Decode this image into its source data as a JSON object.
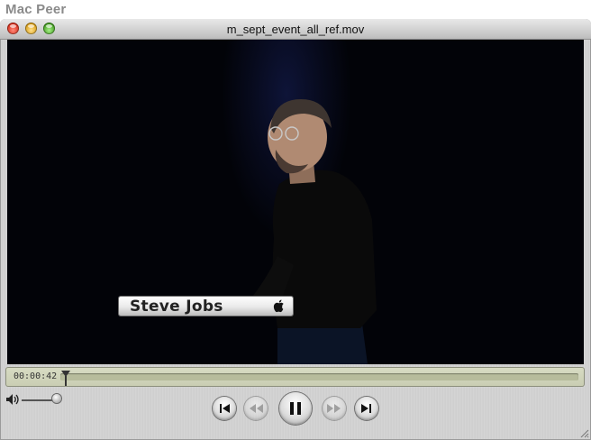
{
  "site": {
    "label": "Mac Peer"
  },
  "window": {
    "title": "m_sept_event_all_ref.mov"
  },
  "video": {
    "lower_third_name": "Steve Jobs",
    "lower_third_logo": "apple-logo-icon"
  },
  "scrubber": {
    "timecode": "00:00:42"
  },
  "controls": {
    "buttons": [
      {
        "name": "go-to-start-button",
        "icon": "skip-to-start-icon",
        "enabled": true
      },
      {
        "name": "rewind-button",
        "icon": "rewind-icon",
        "enabled": false
      },
      {
        "name": "pause-button",
        "icon": "pause-icon",
        "enabled": true
      },
      {
        "name": "fast-forward-button",
        "icon": "fast-forward-icon",
        "enabled": false
      },
      {
        "name": "go-to-end-button",
        "icon": "skip-to-end-icon",
        "enabled": true
      }
    ],
    "volume_icon": "speaker-icon"
  },
  "colors": {
    "close": "#d62a17",
    "minimize": "#d69a12",
    "zoom": "#3e9a1a"
  }
}
